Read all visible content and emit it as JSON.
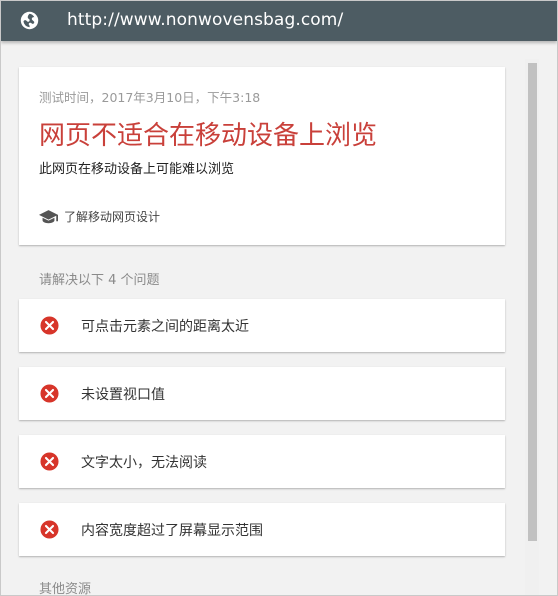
{
  "browser": {
    "url": "http://www.nonwovensbag.com/",
    "url_icon": "globe-icon"
  },
  "summary": {
    "test_time": "测试时间，2017年3月10日，下午3:18",
    "verdict": "网页不适合在移动设备上浏览",
    "subtitle": "此网页在移动设备上可能难以浏览",
    "learn_link": "了解移动网页设计",
    "learn_icon": "graduation-cap-icon",
    "verdict_color": "#c9403a"
  },
  "issues": {
    "heading": "请解决以下 4 个问题",
    "icon": "error-circle-icon",
    "icon_color": "#d7352a",
    "items": [
      {
        "label": "可点击元素之间的距离太近"
      },
      {
        "label": "未设置视口值"
      },
      {
        "label": "文字太小，无法阅读"
      },
      {
        "label": "内容宽度超过了屏幕显示范围"
      }
    ]
  },
  "resources": {
    "heading": "其他资源"
  }
}
